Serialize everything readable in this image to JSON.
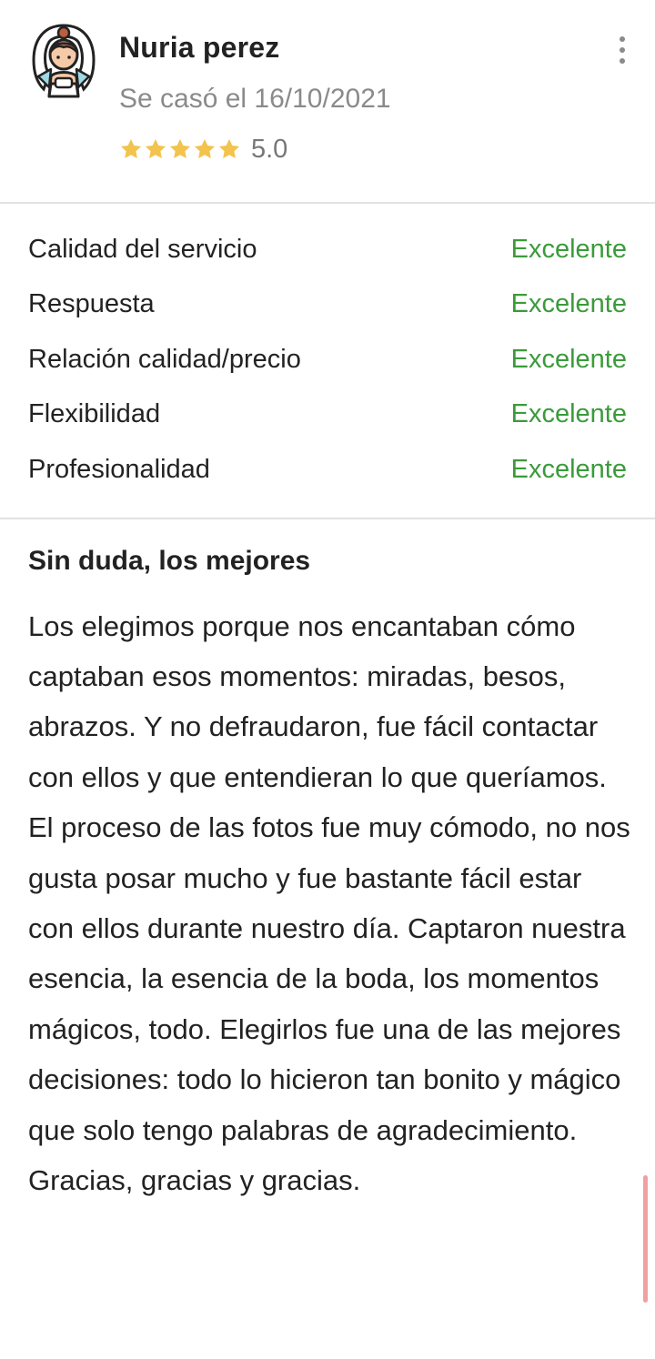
{
  "review": {
    "reviewer_name": "Nuria perez",
    "married_date": "Se casó el 16/10/2021",
    "rating_value": "5.0",
    "stars": 5,
    "stars_filled": 5,
    "star_color": "#f2c34d",
    "avatar_icon": "bride-avatar-icon",
    "more_icon": "more-vertical-icon",
    "categories": [
      {
        "label": "Calidad del servicio",
        "value": "Excelente"
      },
      {
        "label": "Respuesta",
        "value": "Excelente"
      },
      {
        "label": "Relación calidad/precio",
        "value": "Excelente"
      },
      {
        "label": "Flexibilidad",
        "value": "Excelente"
      },
      {
        "label": "Profesionalidad",
        "value": "Excelente"
      }
    ],
    "title": "Sin duda, los mejores",
    "body": "Los elegimos porque nos encantaban cómo captaban esos momentos: miradas, besos, abrazos. Y no defraudaron, fue fácil contactar con ellos y que entendieran lo que queríamos. El proceso de las fotos fue muy cómodo, no nos gusta posar mucho y fue bastante fácil estar con ellos durante nuestro día. Captaron nuestra esencia, la esencia de la boda, los momentos mágicos, todo. Elegirlos fue una de las mejores decisiones: todo lo hicieron tan bonito y mágico que solo tengo palabras de agradecimiento. Gracias, gracias y gracias."
  },
  "colors": {
    "excellent": "#3a9b3a",
    "muted_text": "#8a8a8a",
    "divider": "#e2e2e2",
    "scroll_indicator": "#f0a0a3"
  }
}
